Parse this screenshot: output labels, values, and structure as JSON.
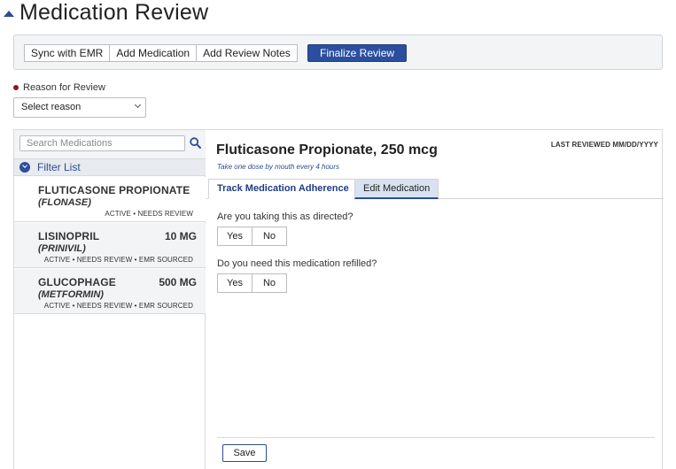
{
  "page": {
    "title": "Medication Review"
  },
  "toolbar": {
    "sync_label": "Sync with EMR",
    "add_med_label": "Add Medication",
    "add_notes_label": "Add Review Notes",
    "finalize_label": "Finalize Review"
  },
  "reason": {
    "label": "Reason for Review",
    "selected": "Select reason"
  },
  "sidebar": {
    "search_placeholder": "Search Medications",
    "filter_label": "Filter List",
    "items": [
      {
        "name": "FLUTICASONE PROPIONATE",
        "dose": "",
        "brand": "(FLONASE)",
        "status": "ACTIVE • NEEDS REVIEW"
      },
      {
        "name": "LISINOPRIL",
        "dose": "10 MG",
        "brand": "(PRINIVIL)",
        "status": "ACTIVE • NEEDS REVIEW • EMR SOURCED"
      },
      {
        "name": "GLUCOPHAGE",
        "dose": "500 MG",
        "brand": "(METFORMIN)",
        "status": "ACTIVE • NEEDS REVIEW • EMR SOURCED"
      }
    ]
  },
  "detail": {
    "title": "Fluticasone Propionate, 250 mcg",
    "instructions": "Take one dose by mouth every 4 hours",
    "last_reviewed": "LAST REVIEWED MM/DD/YYYY",
    "tabs": [
      {
        "label": "Track Medication Adherence"
      },
      {
        "label": "Edit Medication"
      }
    ],
    "questions": [
      {
        "text": "Are you taking this as directed?",
        "yes": "Yes",
        "no": "No"
      },
      {
        "text": "Do you need this medication refilled?",
        "yes": "Yes",
        "no": "No"
      }
    ],
    "save_label": "Save"
  },
  "colors": {
    "primary": "#2b4f9e",
    "required": "#8b1a1a",
    "panel_bg": "#f3f4f6"
  }
}
